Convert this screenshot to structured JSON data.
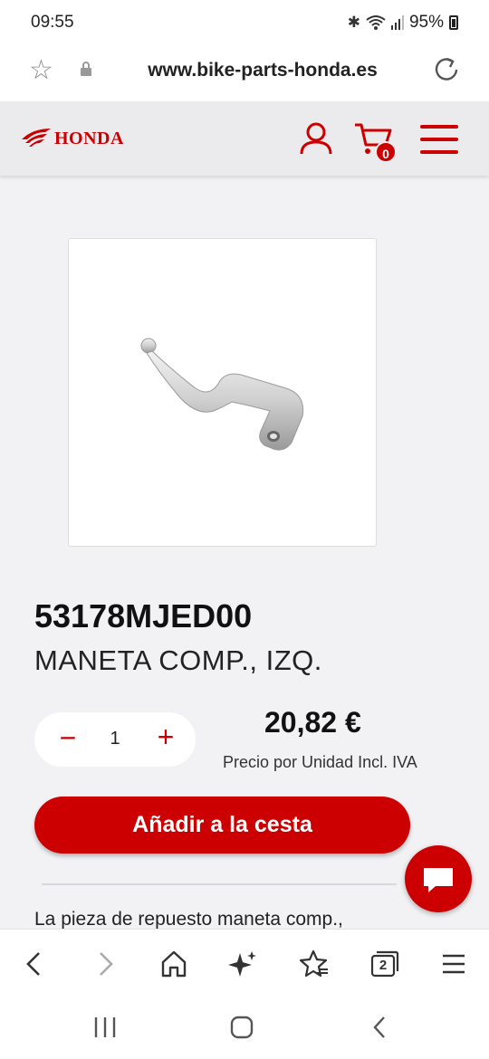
{
  "status_bar": {
    "time": "09:55",
    "battery": "95%"
  },
  "browser": {
    "url": "www.bike-parts-honda.es"
  },
  "site": {
    "logo_text": "HONDA",
    "cart_count": "0"
  },
  "product": {
    "part_number": "53178MJED00",
    "name": "MANETA COMP., IZQ.",
    "quantity": "1",
    "price": "20,82 €",
    "price_note": "Precio por Unidad Incl. IVA",
    "add_to_cart_label": "Añadir a la cesta",
    "description_start": "La pieza de repuesto maneta comp.,"
  },
  "toolbar": {
    "tabs_count": "2"
  },
  "colors": {
    "brand": "#cc0000"
  },
  "icons": {
    "status": [
      "bluetooth-icon",
      "wifi-icon",
      "signal-icon",
      "battery-icon"
    ],
    "header": [
      "honda-wing-icon",
      "user-icon",
      "cart-icon",
      "menu-icon"
    ],
    "toolbar": [
      "back-icon",
      "forward-icon",
      "home-icon",
      "sparkle-icon",
      "bookmarks-icon",
      "tabs-icon",
      "menu-icon"
    ],
    "navbar": [
      "recents-icon",
      "home-icon",
      "back-icon"
    ]
  }
}
